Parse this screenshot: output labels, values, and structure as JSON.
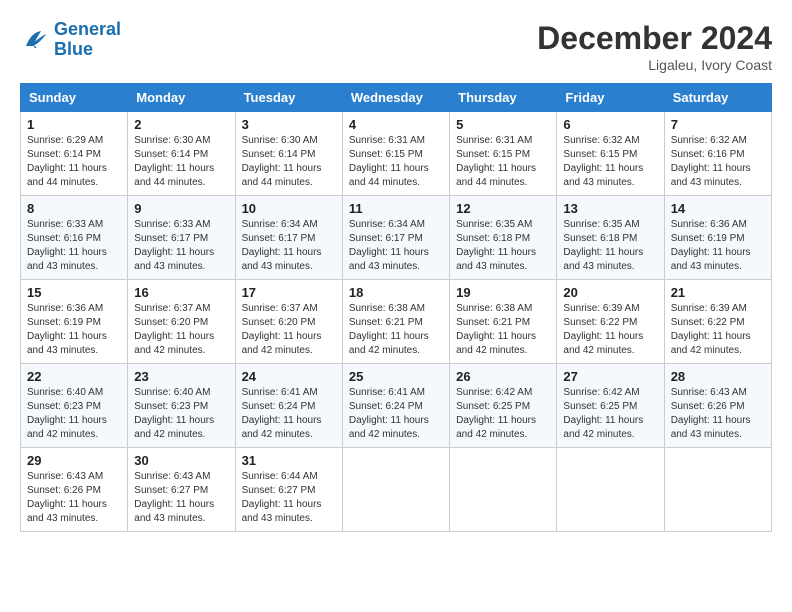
{
  "logo": {
    "line1": "General",
    "line2": "Blue"
  },
  "title": "December 2024",
  "location": "Ligaleu, Ivory Coast",
  "days_of_week": [
    "Sunday",
    "Monday",
    "Tuesday",
    "Wednesday",
    "Thursday",
    "Friday",
    "Saturday"
  ],
  "weeks": [
    [
      {
        "day": "1",
        "sunrise": "6:29 AM",
        "sunset": "6:14 PM",
        "daylight": "11 hours and 44 minutes."
      },
      {
        "day": "2",
        "sunrise": "6:30 AM",
        "sunset": "6:14 PM",
        "daylight": "11 hours and 44 minutes."
      },
      {
        "day": "3",
        "sunrise": "6:30 AM",
        "sunset": "6:14 PM",
        "daylight": "11 hours and 44 minutes."
      },
      {
        "day": "4",
        "sunrise": "6:31 AM",
        "sunset": "6:15 PM",
        "daylight": "11 hours and 44 minutes."
      },
      {
        "day": "5",
        "sunrise": "6:31 AM",
        "sunset": "6:15 PM",
        "daylight": "11 hours and 44 minutes."
      },
      {
        "day": "6",
        "sunrise": "6:32 AM",
        "sunset": "6:15 PM",
        "daylight": "11 hours and 43 minutes."
      },
      {
        "day": "7",
        "sunrise": "6:32 AM",
        "sunset": "6:16 PM",
        "daylight": "11 hours and 43 minutes."
      }
    ],
    [
      {
        "day": "8",
        "sunrise": "6:33 AM",
        "sunset": "6:16 PM",
        "daylight": "11 hours and 43 minutes."
      },
      {
        "day": "9",
        "sunrise": "6:33 AM",
        "sunset": "6:17 PM",
        "daylight": "11 hours and 43 minutes."
      },
      {
        "day": "10",
        "sunrise": "6:34 AM",
        "sunset": "6:17 PM",
        "daylight": "11 hours and 43 minutes."
      },
      {
        "day": "11",
        "sunrise": "6:34 AM",
        "sunset": "6:17 PM",
        "daylight": "11 hours and 43 minutes."
      },
      {
        "day": "12",
        "sunrise": "6:35 AM",
        "sunset": "6:18 PM",
        "daylight": "11 hours and 43 minutes."
      },
      {
        "day": "13",
        "sunrise": "6:35 AM",
        "sunset": "6:18 PM",
        "daylight": "11 hours and 43 minutes."
      },
      {
        "day": "14",
        "sunrise": "6:36 AM",
        "sunset": "6:19 PM",
        "daylight": "11 hours and 43 minutes."
      }
    ],
    [
      {
        "day": "15",
        "sunrise": "6:36 AM",
        "sunset": "6:19 PM",
        "daylight": "11 hours and 43 minutes."
      },
      {
        "day": "16",
        "sunrise": "6:37 AM",
        "sunset": "6:20 PM",
        "daylight": "11 hours and 42 minutes."
      },
      {
        "day": "17",
        "sunrise": "6:37 AM",
        "sunset": "6:20 PM",
        "daylight": "11 hours and 42 minutes."
      },
      {
        "day": "18",
        "sunrise": "6:38 AM",
        "sunset": "6:21 PM",
        "daylight": "11 hours and 42 minutes."
      },
      {
        "day": "19",
        "sunrise": "6:38 AM",
        "sunset": "6:21 PM",
        "daylight": "11 hours and 42 minutes."
      },
      {
        "day": "20",
        "sunrise": "6:39 AM",
        "sunset": "6:22 PM",
        "daylight": "11 hours and 42 minutes."
      },
      {
        "day": "21",
        "sunrise": "6:39 AM",
        "sunset": "6:22 PM",
        "daylight": "11 hours and 42 minutes."
      }
    ],
    [
      {
        "day": "22",
        "sunrise": "6:40 AM",
        "sunset": "6:23 PM",
        "daylight": "11 hours and 42 minutes."
      },
      {
        "day": "23",
        "sunrise": "6:40 AM",
        "sunset": "6:23 PM",
        "daylight": "11 hours and 42 minutes."
      },
      {
        "day": "24",
        "sunrise": "6:41 AM",
        "sunset": "6:24 PM",
        "daylight": "11 hours and 42 minutes."
      },
      {
        "day": "25",
        "sunrise": "6:41 AM",
        "sunset": "6:24 PM",
        "daylight": "11 hours and 42 minutes."
      },
      {
        "day": "26",
        "sunrise": "6:42 AM",
        "sunset": "6:25 PM",
        "daylight": "11 hours and 42 minutes."
      },
      {
        "day": "27",
        "sunrise": "6:42 AM",
        "sunset": "6:25 PM",
        "daylight": "11 hours and 42 minutes."
      },
      {
        "day": "28",
        "sunrise": "6:43 AM",
        "sunset": "6:26 PM",
        "daylight": "11 hours and 43 minutes."
      }
    ],
    [
      {
        "day": "29",
        "sunrise": "6:43 AM",
        "sunset": "6:26 PM",
        "daylight": "11 hours and 43 minutes."
      },
      {
        "day": "30",
        "sunrise": "6:43 AM",
        "sunset": "6:27 PM",
        "daylight": "11 hours and 43 minutes."
      },
      {
        "day": "31",
        "sunrise": "6:44 AM",
        "sunset": "6:27 PM",
        "daylight": "11 hours and 43 minutes."
      },
      null,
      null,
      null,
      null
    ]
  ],
  "labels": {
    "sunrise_prefix": "Sunrise: ",
    "sunset_prefix": "Sunset: ",
    "daylight_prefix": "Daylight: "
  }
}
